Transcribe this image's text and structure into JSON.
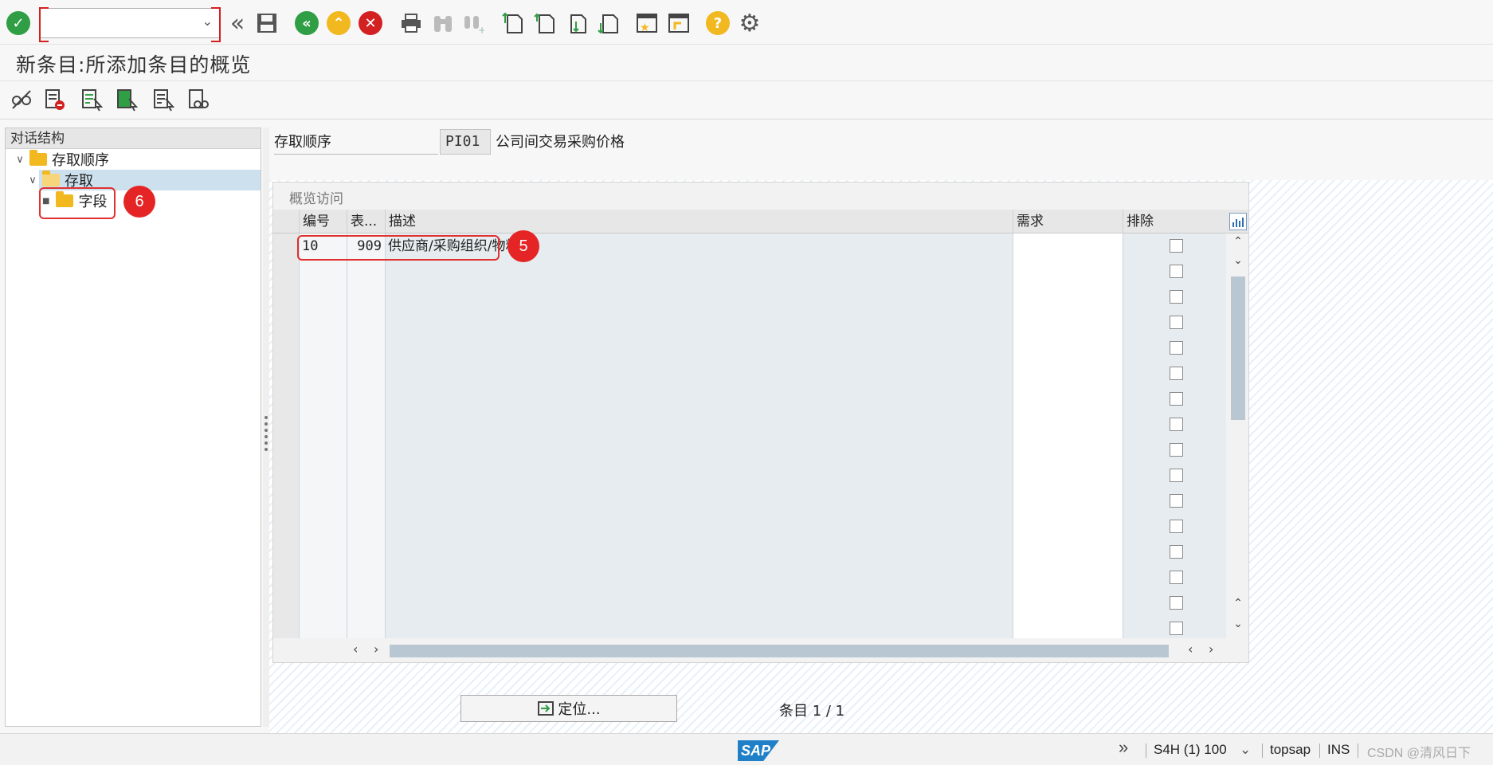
{
  "toolbar": {
    "command_field_value": "",
    "icons": [
      "check-icon",
      "back-double-icon",
      "save-icon",
      "back-icon",
      "exit-icon",
      "cancel-icon",
      "print-icon",
      "find-icon",
      "find-next-icon",
      "first-page-icon",
      "previous-page-icon",
      "next-page-icon",
      "last-page-icon",
      "new-session-icon",
      "shortcut-icon",
      "help-icon",
      "settings-icon"
    ],
    "colors": {
      "confirm": "#2f9e44",
      "back": "#2f9e44",
      "exit": "#f2b820",
      "cancel": "#d32020",
      "help": "#f2b820"
    }
  },
  "title": "新条目:所添加条目的概览",
  "app_toolbar": {
    "icons": [
      "display-change-icon",
      "delete-row-icon",
      "select-all-icon",
      "select-block-icon",
      "deselect-all-icon",
      "where-used-icon"
    ]
  },
  "tree": {
    "header": "对话结构",
    "nodes": [
      {
        "label": "存取顺序",
        "level": 0,
        "expanded": true
      },
      {
        "label": "存取",
        "level": 1,
        "expanded": true,
        "selected": true
      },
      {
        "label": "字段",
        "level": 2
      }
    ],
    "callout": "6"
  },
  "form": {
    "seq_label": "存取顺序",
    "seq_code": "PI01",
    "seq_desc": "公司间交易采购价格"
  },
  "table": {
    "title": "概览访问",
    "columns": [
      "编号",
      "表...",
      "描述",
      "需求",
      "排除"
    ],
    "rows": [
      {
        "no": "10",
        "table": "909",
        "desc": "供应商/采购组织/物料",
        "req": "",
        "exclude": false
      },
      {
        "no": "",
        "table": "",
        "desc": "",
        "req": "",
        "exclude": false
      },
      {
        "no": "",
        "table": "",
        "desc": "",
        "req": "",
        "exclude": false
      },
      {
        "no": "",
        "table": "",
        "desc": "",
        "req": "",
        "exclude": false
      },
      {
        "no": "",
        "table": "",
        "desc": "",
        "req": "",
        "exclude": false
      },
      {
        "no": "",
        "table": "",
        "desc": "",
        "req": "",
        "exclude": false
      },
      {
        "no": "",
        "table": "",
        "desc": "",
        "req": "",
        "exclude": false
      },
      {
        "no": "",
        "table": "",
        "desc": "",
        "req": "",
        "exclude": false
      },
      {
        "no": "",
        "table": "",
        "desc": "",
        "req": "",
        "exclude": false
      },
      {
        "no": "",
        "table": "",
        "desc": "",
        "req": "",
        "exclude": false
      },
      {
        "no": "",
        "table": "",
        "desc": "",
        "req": "",
        "exclude": false
      },
      {
        "no": "",
        "table": "",
        "desc": "",
        "req": "",
        "exclude": false
      },
      {
        "no": "",
        "table": "",
        "desc": "",
        "req": "",
        "exclude": false
      },
      {
        "no": "",
        "table": "",
        "desc": "",
        "req": "",
        "exclude": false
      },
      {
        "no": "",
        "table": "",
        "desc": "",
        "req": "",
        "exclude": false
      },
      {
        "no": "",
        "table": "",
        "desc": "",
        "req": "",
        "exclude": false
      }
    ],
    "callout": "5"
  },
  "locate_button": "定位...",
  "entry_count": "条目 1 / 1",
  "status": {
    "system": "S4H (1) 100",
    "user": "topsap",
    "mode": "INS",
    "watermark": "CSDN @清风日下"
  }
}
